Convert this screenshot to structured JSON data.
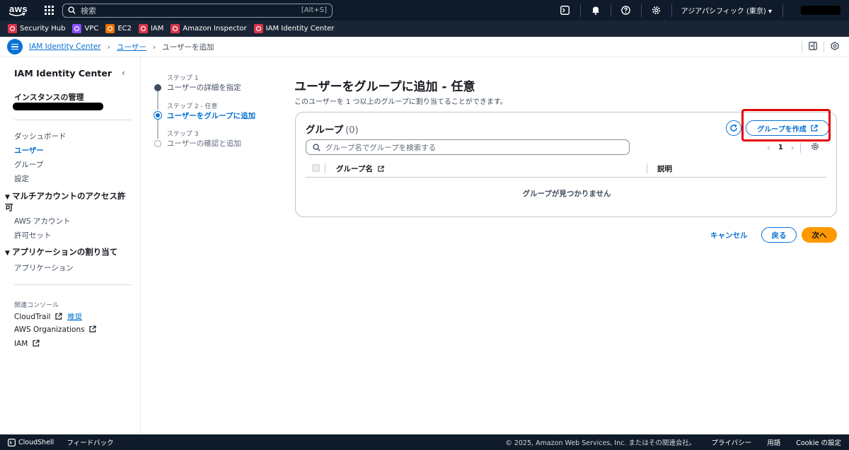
{
  "topnav": {
    "logo_text": "aws",
    "search_placeholder": "検索",
    "search_shortcut": "[Alt+S]",
    "region": "アジアパシフィック (東京)",
    "icons": [
      "cloudshell-icon",
      "bell-icon",
      "help-icon",
      "gear-icon"
    ]
  },
  "favorites": [
    {
      "label": "Security Hub",
      "color": "#dd344c"
    },
    {
      "label": "VPC",
      "color": "#8c4fff"
    },
    {
      "label": "EC2",
      "color": "#ed7100"
    },
    {
      "label": "IAM",
      "color": "#dd344c"
    },
    {
      "label": "Amazon Inspector",
      "color": "#dd344c"
    },
    {
      "label": "IAM Identity Center",
      "color": "#dd344c"
    }
  ],
  "breadcrumb": {
    "items": [
      "IAM Identity Center",
      "ユーザー"
    ],
    "current": "ユーザーを追加"
  },
  "sidebar": {
    "title": "IAM Identity Center",
    "instance_heading": "インスタンスの管理",
    "links": [
      "ダッシュボード",
      "ユーザー",
      "グループ",
      "設定"
    ],
    "active_link": "ユーザー",
    "section1": "マルチアカウントのアクセス許可",
    "section1_links": [
      "AWS アカウント",
      "許可セット"
    ],
    "section2": "アプリケーションの割り当て",
    "section2_links": [
      "アプリケーション"
    ],
    "related_heading": "関連コンソール",
    "related": [
      {
        "label": "CloudTrail",
        "badge": "推奨"
      },
      {
        "label": "AWS Organizations"
      },
      {
        "label": "IAM"
      }
    ]
  },
  "steps": [
    {
      "label": "ステップ 1",
      "name": "ユーザーの詳細を指定",
      "state": "done"
    },
    {
      "label": "ステップ 2 - 任意",
      "name": "ユーザーをグループに追加",
      "state": "active"
    },
    {
      "label": "ステップ 3",
      "name": "ユーザーの確認と追加",
      "state": "todo"
    }
  ],
  "main": {
    "title": "ユーザーをグループに追加 - 任意",
    "description": "このユーザーを 1 つ以上のグループに割り当てることができます。",
    "panel": {
      "title": "グループ",
      "count": "(0)",
      "create_button": "グループを作成",
      "search_placeholder": "グループ名でグループを検索する",
      "page": "1",
      "columns": [
        "グループ名",
        "説明"
      ],
      "empty_text": "グループが見つかりません"
    },
    "actions": {
      "cancel": "キャンセル",
      "back": "戻る",
      "next": "次へ"
    }
  },
  "footer": {
    "cloudshell": "CloudShell",
    "feedback": "フィードバック",
    "copyright": "© 2025, Amazon Web Services, Inc. またはその関連会社。",
    "links": [
      "プライバシー",
      "用語",
      "Cookie の設定"
    ]
  },
  "colors": {
    "accent": "#0972d3",
    "primary_button": "#ff9900",
    "nav_bg": "#0f1b2a",
    "highlight": "#e50000"
  }
}
